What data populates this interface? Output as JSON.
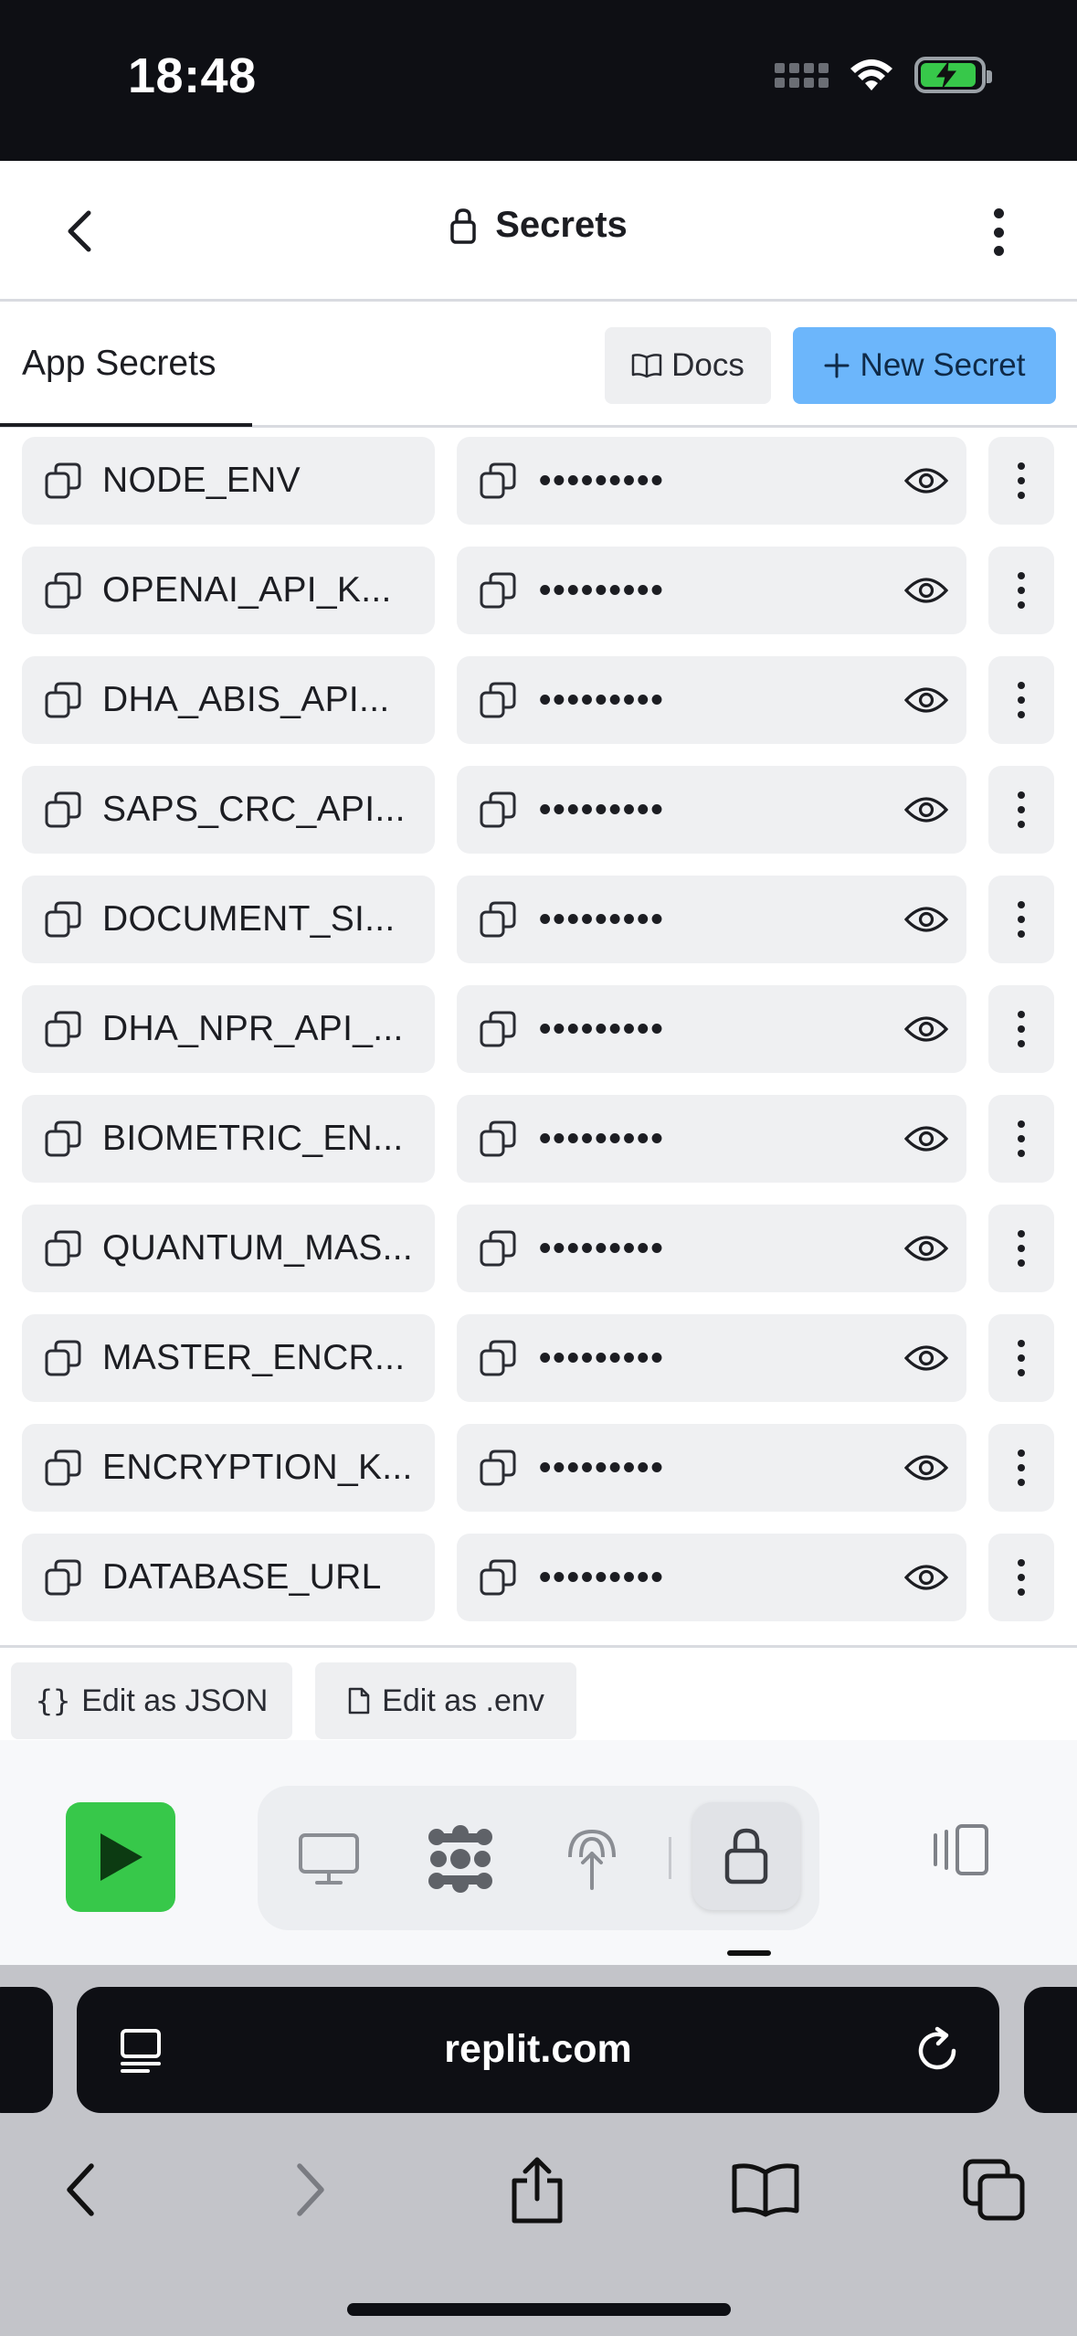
{
  "status_bar": {
    "time": "18:48"
  },
  "header": {
    "title": "Secrets"
  },
  "tabs": {
    "active_label": "App Secrets"
  },
  "actions": {
    "docs_label": "Docs",
    "new_secret_label": "New Secret"
  },
  "secrets": [
    {
      "key": "NODE_ENV",
      "value_masked": "•••••••••"
    },
    {
      "key": "OPENAI_API_K...",
      "value_masked": "•••••••••"
    },
    {
      "key": "DHA_ABIS_API...",
      "value_masked": "•••••••••"
    },
    {
      "key": "SAPS_CRC_API...",
      "value_masked": "•••••••••"
    },
    {
      "key": "DOCUMENT_SI...",
      "value_masked": "•••••••••"
    },
    {
      "key": "DHA_NPR_API_...",
      "value_masked": "•••••••••"
    },
    {
      "key": "BIOMETRIC_EN...",
      "value_masked": "•••••••••"
    },
    {
      "key": "QUANTUM_MAS...",
      "value_masked": "•••••••••"
    },
    {
      "key": "MASTER_ENCR...",
      "value_masked": "•••••••••"
    },
    {
      "key": "ENCRYPTION_K...",
      "value_masked": "•••••••••"
    },
    {
      "key": "DATABASE_URL",
      "value_masked": "•••••••••"
    }
  ],
  "edit_bar": {
    "json_label": "Edit as JSON",
    "env_label": "Edit as .env"
  },
  "toolbar": {
    "tools": [
      "desktop-icon",
      "extensions-icon",
      "deploy-icon",
      "lock-icon"
    ],
    "active_tool": "lock-icon",
    "run_color": "#37c84a"
  },
  "browser": {
    "url": "replit.com"
  },
  "colors": {
    "accent": "#6cb6fb",
    "field_bg": "#eff0f2",
    "status_bg": "#0e0f14"
  }
}
